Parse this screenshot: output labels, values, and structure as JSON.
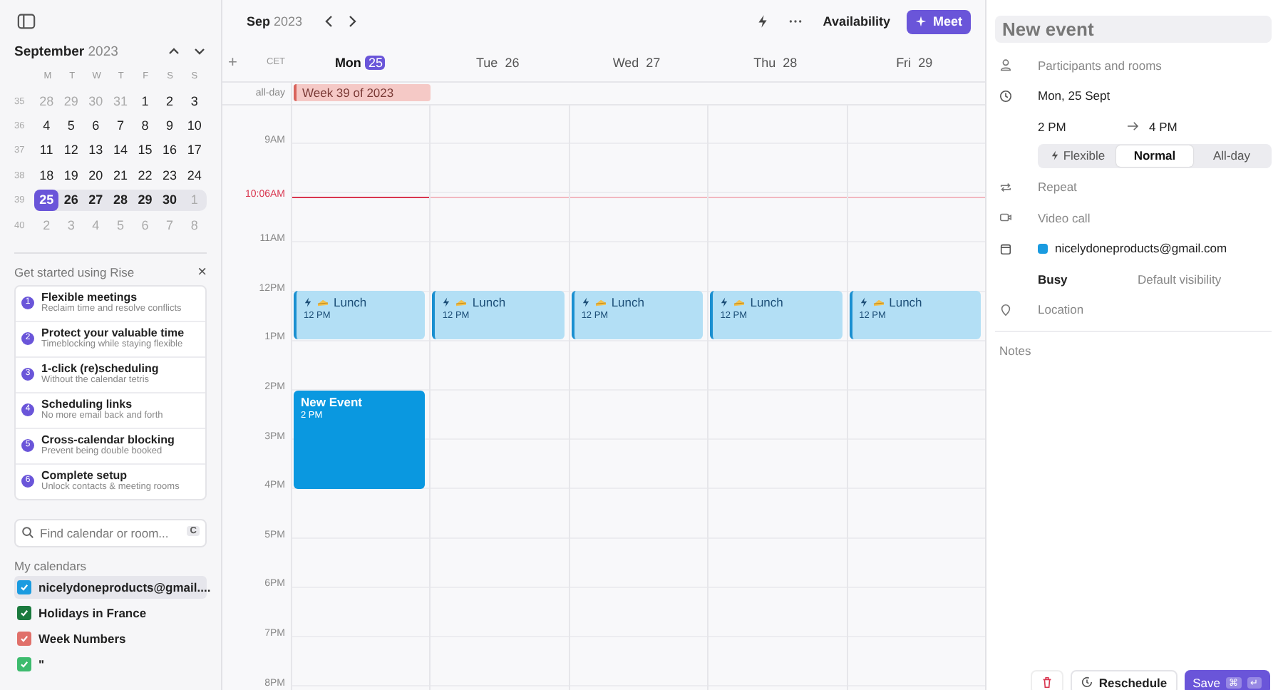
{
  "sidebar": {
    "month": "September",
    "year": "2023",
    "weekdays": [
      "M",
      "T",
      "W",
      "T",
      "F",
      "S",
      "S"
    ],
    "weeks": [
      {
        "week": "35",
        "current": false,
        "days": [
          {
            "d": "28",
            "muted": true,
            "selected": false
          },
          {
            "d": "29",
            "muted": true,
            "selected": false
          },
          {
            "d": "30",
            "muted": true,
            "selected": false
          },
          {
            "d": "31",
            "muted": true,
            "selected": false
          },
          {
            "d": "1",
            "muted": false,
            "selected": false
          },
          {
            "d": "2",
            "muted": false,
            "selected": false
          },
          {
            "d": "3",
            "muted": false,
            "selected": false
          }
        ]
      },
      {
        "week": "36",
        "current": false,
        "days": [
          {
            "d": "4",
            "muted": false,
            "selected": false
          },
          {
            "d": "5",
            "muted": false,
            "selected": false
          },
          {
            "d": "6",
            "muted": false,
            "selected": false
          },
          {
            "d": "7",
            "muted": false,
            "selected": false
          },
          {
            "d": "8",
            "muted": false,
            "selected": false
          },
          {
            "d": "9",
            "muted": false,
            "selected": false
          },
          {
            "d": "10",
            "muted": false,
            "selected": false
          }
        ]
      },
      {
        "week": "37",
        "current": false,
        "days": [
          {
            "d": "11",
            "muted": false,
            "selected": false
          },
          {
            "d": "12",
            "muted": false,
            "selected": false
          },
          {
            "d": "13",
            "muted": false,
            "selected": false
          },
          {
            "d": "14",
            "muted": false,
            "selected": false
          },
          {
            "d": "15",
            "muted": false,
            "selected": false
          },
          {
            "d": "16",
            "muted": false,
            "selected": false
          },
          {
            "d": "17",
            "muted": false,
            "selected": false
          }
        ]
      },
      {
        "week": "38",
        "current": false,
        "days": [
          {
            "d": "18",
            "muted": false,
            "selected": false
          },
          {
            "d": "19",
            "muted": false,
            "selected": false
          },
          {
            "d": "20",
            "muted": false,
            "selected": false
          },
          {
            "d": "21",
            "muted": false,
            "selected": false
          },
          {
            "d": "22",
            "muted": false,
            "selected": false
          },
          {
            "d": "23",
            "muted": false,
            "selected": false
          },
          {
            "d": "24",
            "muted": false,
            "selected": false
          }
        ]
      },
      {
        "week": "39",
        "current": true,
        "days": [
          {
            "d": "25",
            "muted": false,
            "selected": true
          },
          {
            "d": "26",
            "muted": false,
            "selected": false
          },
          {
            "d": "27",
            "muted": false,
            "selected": false
          },
          {
            "d": "28",
            "muted": false,
            "selected": false
          },
          {
            "d": "29",
            "muted": false,
            "selected": false
          },
          {
            "d": "30",
            "muted": false,
            "selected": false
          },
          {
            "d": "1",
            "muted": true,
            "selected": false
          }
        ]
      },
      {
        "week": "40",
        "current": false,
        "days": [
          {
            "d": "2",
            "muted": true,
            "selected": false
          },
          {
            "d": "3",
            "muted": true,
            "selected": false
          },
          {
            "d": "4",
            "muted": true,
            "selected": false
          },
          {
            "d": "5",
            "muted": true,
            "selected": false
          },
          {
            "d": "6",
            "muted": true,
            "selected": false
          },
          {
            "d": "7",
            "muted": true,
            "selected": false
          },
          {
            "d": "8",
            "muted": true,
            "selected": false
          }
        ]
      }
    ],
    "get_started": {
      "title": "Get started using Rise",
      "close": "×",
      "items": [
        {
          "num": "1",
          "title": "Flexible meetings",
          "subtitle": "Reclaim time and resolve conflicts"
        },
        {
          "num": "2",
          "title": "Protect your valuable time",
          "subtitle": "Timeblocking while staying flexible"
        },
        {
          "num": "3",
          "title": "1-click (re)scheduling",
          "subtitle": "Without the calendar tetris"
        },
        {
          "num": "4",
          "title": "Scheduling links",
          "subtitle": "No more email back and forth"
        },
        {
          "num": "5",
          "title": "Cross-calendar blocking",
          "subtitle": "Prevent being double booked"
        },
        {
          "num": "6",
          "title": "Complete setup",
          "subtitle": "Unlock contacts & meeting rooms"
        }
      ]
    },
    "search": {
      "placeholder": "Find calendar or room...",
      "shortcut": "C"
    },
    "calendars_title": "My calendars",
    "calendars": [
      {
        "name": "nicelydoneproducts@gmail....",
        "color": "#1a9be0",
        "checked": true,
        "selected": true
      },
      {
        "name": "Holidays in France",
        "color": "#1b7a3e",
        "checked": true,
        "selected": false
      },
      {
        "name": "Week Numbers",
        "color": "#e0706a",
        "checked": true,
        "selected": false
      },
      {
        "name": "\"",
        "color": "#3dbb6e",
        "checked": true,
        "selected": false
      }
    ]
  },
  "toolbar": {
    "month": "Sep",
    "year": "2023",
    "availability": "Availability",
    "meet": "Meet"
  },
  "calendar": {
    "add": "+",
    "timezone": "CET",
    "allday_label": "all-day",
    "allday_event": "Week 39 of 2023",
    "days": [
      {
        "name": "Mon",
        "date": "25",
        "selected": true,
        "events": [
          {
            "kind": "lunch",
            "title": "Lunch",
            "time": "12 PM"
          },
          {
            "kind": "draft",
            "title": "New Event",
            "time": "2 PM"
          }
        ]
      },
      {
        "name": "Tue",
        "date": "26",
        "selected": false,
        "events": [
          {
            "kind": "lunch",
            "title": "Lunch",
            "time": "12 PM"
          }
        ]
      },
      {
        "name": "Wed",
        "date": "27",
        "selected": false,
        "events": [
          {
            "kind": "lunch",
            "title": "Lunch",
            "time": "12 PM"
          }
        ]
      },
      {
        "name": "Thu",
        "date": "28",
        "selected": false,
        "events": [
          {
            "kind": "lunch",
            "title": "Lunch",
            "time": "12 PM"
          }
        ]
      },
      {
        "name": "Fri",
        "date": "29",
        "selected": false,
        "events": [
          {
            "kind": "lunch",
            "title": "Lunch",
            "time": "12 PM"
          }
        ]
      }
    ],
    "hours": [
      {
        "label": "9AM",
        "kind": "hour"
      },
      {
        "label": "10:06AM",
        "kind": "now"
      },
      {
        "label": "11AM",
        "kind": "hour"
      },
      {
        "label": "12PM",
        "kind": "hour"
      },
      {
        "label": "1PM",
        "kind": "hour"
      },
      {
        "label": "2PM",
        "kind": "hour"
      },
      {
        "label": "3PM",
        "kind": "hour"
      },
      {
        "label": "4PM",
        "kind": "hour"
      },
      {
        "label": "5PM",
        "kind": "hour"
      },
      {
        "label": "6PM",
        "kind": "hour"
      },
      {
        "label": "7PM",
        "kind": "hour"
      },
      {
        "label": "8PM",
        "kind": "hour"
      }
    ]
  },
  "panel": {
    "title": "New event",
    "participants": "Participants and rooms",
    "date": "Mon, 25 Sept",
    "start": "2 PM",
    "end": "4 PM",
    "modes": [
      {
        "label": "Flexible",
        "kind": "flexible",
        "selected": false
      },
      {
        "label": "Normal",
        "kind": "plain",
        "selected": true
      },
      {
        "label": "All-day",
        "kind": "plain",
        "selected": false
      }
    ],
    "repeat": "Repeat",
    "video": "Video call",
    "calendar": {
      "name": "nicelydoneproducts@gmail.com",
      "color": "#1a9be0"
    },
    "busy": "Busy",
    "visibility": "Default visibility",
    "location": "Location",
    "notes": "Notes",
    "reschedule": "Reschedule",
    "save": "Save",
    "save_keys": [
      "⌘",
      "↵"
    ]
  }
}
